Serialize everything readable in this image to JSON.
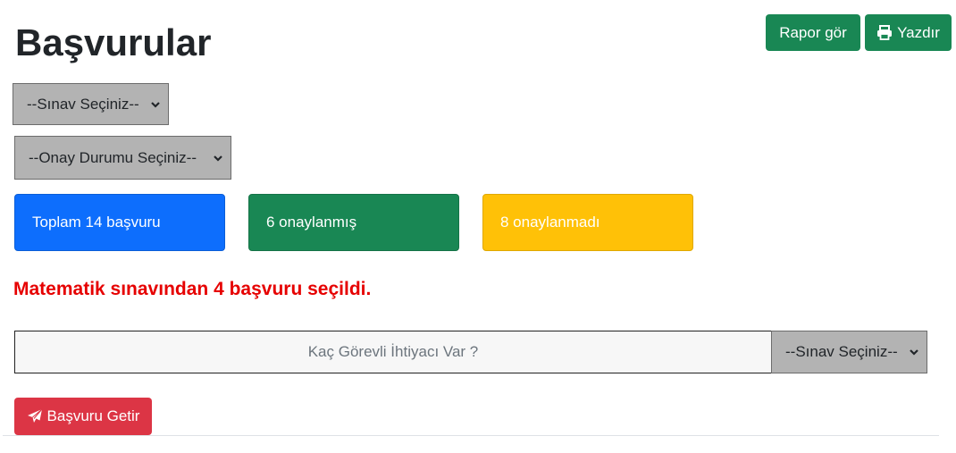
{
  "header": {
    "title": "Başvurular",
    "report_button": "Rapor gör",
    "print_button": "Yazdır"
  },
  "filters": {
    "exam_select": "--Sınav Seçiniz--",
    "status_select": "--Onay Durumu Seçiniz--"
  },
  "stats": {
    "total": "Toplam 14 başvuru",
    "approved": "6 onaylanmış",
    "pending": "8 onaylanmadı"
  },
  "message": "Matematik sınavından 4 başvuru seçildi.",
  "assignment": {
    "count_placeholder": "Kaç Görevli İhtiyacı Var ?",
    "count_value": "",
    "exam_select": "--Sınav Seçiniz--"
  },
  "fetch_button": "Başvuru Getir",
  "colors": {
    "primary": "#0d6efd",
    "success": "#198754",
    "warning": "#ffc107",
    "danger": "#dc3545",
    "message": "#e60000",
    "select_bg": "#b3b3b3"
  },
  "icons": {
    "print": "printer-icon",
    "fetch": "paper-plane-icon",
    "select": "chevron-down-icon"
  }
}
